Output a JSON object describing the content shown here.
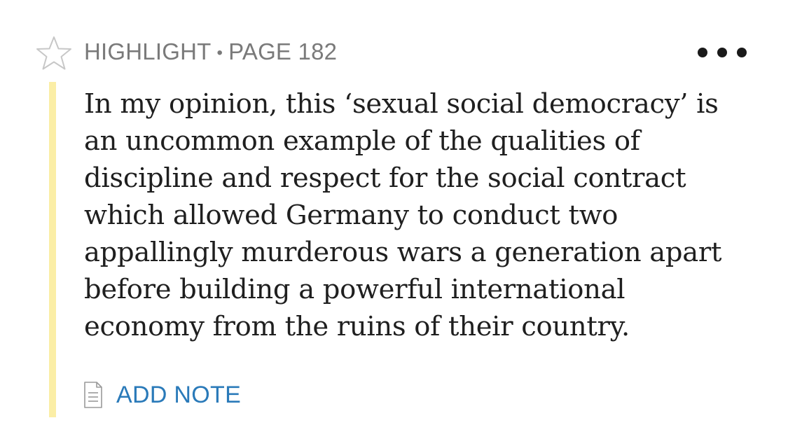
{
  "header": {
    "type_label": "HIGHLIGHT",
    "separator": "•",
    "page_label": "PAGE 182"
  },
  "highlight": {
    "color": "#fbeea6",
    "lines": [
      "In my opinion, this ‘sexual social democracy’ is",
      "an uncommon example of the qualities of",
      "discipline and respect for the social contract",
      "which allowed Germany to conduct two",
      "appallingly murderous wars a generation apart",
      "before building a powerful international",
      "economy from the ruins of their country."
    ]
  },
  "actions": {
    "add_note_label": "ADD NOTE",
    "add_note_icon": "note-icon",
    "favorite_icon": "star-icon",
    "more_icon": "more-options-icon"
  },
  "colors": {
    "header_text": "#7a7a7a",
    "link": "#2a7ab9",
    "body_text": "#1f1f1f"
  }
}
